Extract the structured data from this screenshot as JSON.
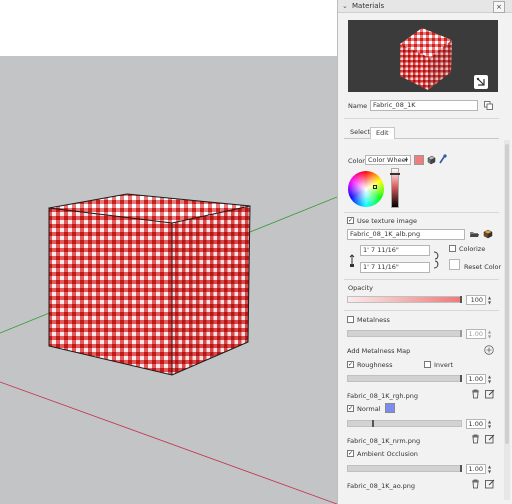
{
  "panel": {
    "title": "Materials",
    "close_glyph": "×",
    "collapse_glyph": "⌄"
  },
  "name_label": "Name",
  "name_value": "Fabric_08_1K",
  "tabs": [
    "Select",
    "Edit"
  ],
  "active_tab": "Edit",
  "color": {
    "label": "Color:",
    "mode": "Color Wheel",
    "swatch": "#ef7d7d"
  },
  "texture": {
    "use_label": "Use texture image",
    "use_checked": "✓",
    "file": "Fabric_08_1K_alb.png",
    "width": "1' 7 11/16\"",
    "height": "1' 7 11/16\"",
    "colorize_label": "Colorize",
    "reset_label": "Reset Color"
  },
  "opacity": {
    "label": "Opacity",
    "value": "100"
  },
  "metalness": {
    "label": "Metalness",
    "value": "1.00"
  },
  "add_metalness_map": "Add Metalness Map",
  "roughness": {
    "label": "Roughness",
    "checked": "✓",
    "invert_label": "Invert",
    "value": "1.00",
    "file": "Fabric_08_1K_rgh.png"
  },
  "normal": {
    "label": "Normal",
    "checked": "✓",
    "value": "1.00",
    "file": "Fabric_08_1K_nrm.png"
  },
  "ambient_occlusion": {
    "label": "Ambient Occlusion",
    "checked": "✓",
    "value": "1.00",
    "file": "Fabric_08_1K_ao.png"
  },
  "colors": {
    "sky": "#ffffff",
    "ground": "#c3c4c6",
    "cube_red": "#d42a2a",
    "axis_red": "#c0304a",
    "axis_green": "#2e9a2e"
  }
}
